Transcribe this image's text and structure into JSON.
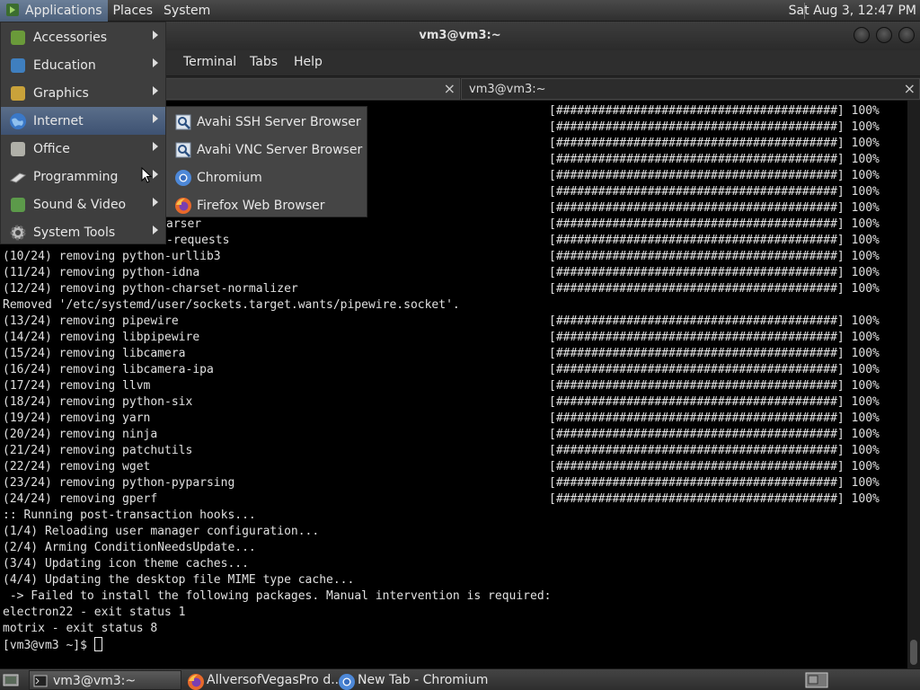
{
  "top_panel": {
    "applications": "Applications",
    "places": "Places",
    "system": "System",
    "clock": "Sat Aug  3, 12:47 PM"
  },
  "window": {
    "title": "vm3@vm3:~",
    "menu": {
      "terminal": "Terminal",
      "tabs": "Tabs",
      "help": "Help"
    },
    "tabs": [
      {
        "label": ""
      },
      {
        "label": "vm3@vm3:~"
      }
    ]
  },
  "terminal": {
    "partial_lines": [
      {
        "row": 7,
        "text": "arser"
      },
      {
        "row": 8,
        "text": "-requests"
      }
    ],
    "lines": [
      {
        "row": 9,
        "text": "(10/24) removing python-urllib3"
      },
      {
        "row": 10,
        "text": "(11/24) removing python-idna"
      },
      {
        "row": 11,
        "text": "(12/24) removing python-charset-normalizer"
      },
      {
        "row": 12,
        "text": "Removed '/etc/systemd/user/sockets.target.wants/pipewire.socket'."
      },
      {
        "row": 13,
        "text": "(13/24) removing pipewire"
      },
      {
        "row": 14,
        "text": "(14/24) removing libpipewire"
      },
      {
        "row": 15,
        "text": "(15/24) removing libcamera"
      },
      {
        "row": 16,
        "text": "(16/24) removing libcamera-ipa"
      },
      {
        "row": 17,
        "text": "(17/24) removing llvm"
      },
      {
        "row": 18,
        "text": "(18/24) removing python-six"
      },
      {
        "row": 19,
        "text": "(19/24) removing yarn"
      },
      {
        "row": 20,
        "text": "(20/24) removing ninja"
      },
      {
        "row": 21,
        "text": "(21/24) removing patchutils"
      },
      {
        "row": 22,
        "text": "(22/24) removing wget"
      },
      {
        "row": 23,
        "text": "(23/24) removing python-pyparsing"
      },
      {
        "row": 24,
        "text": "(24/24) removing gperf"
      },
      {
        "row": 25,
        "text": ":: Running post-transaction hooks..."
      },
      {
        "row": 26,
        "text": "(1/4) Reloading user manager configuration..."
      },
      {
        "row": 27,
        "text": "(2/4) Arming ConditionNeedsUpdate..."
      },
      {
        "row": 28,
        "text": "(3/4) Updating icon theme caches..."
      },
      {
        "row": 29,
        "text": "(4/4) Updating the desktop file MIME type cache..."
      },
      {
        "row": 30,
        "text": " -> Failed to install the following packages. Manual intervention is required:"
      },
      {
        "row": 31,
        "text": "electron22 - exit status 1"
      },
      {
        "row": 32,
        "text": "motrix - exit status 8"
      }
    ],
    "prompt": "[vm3@vm3 ~]$ ",
    "progress_bar": "[########################################] 100%",
    "progress_rows": [
      0,
      1,
      2,
      3,
      4,
      5,
      6,
      7,
      8,
      9,
      10,
      11,
      13,
      14,
      15,
      16,
      17,
      18,
      19,
      20,
      21,
      22,
      23,
      24
    ]
  },
  "apps_menu": {
    "items": [
      {
        "label": "Accessories",
        "icon": "accessories-icon",
        "color": "#6a9a3a"
      },
      {
        "label": "Education",
        "icon": "education-icon",
        "color": "#3f7fbf"
      },
      {
        "label": "Graphics",
        "icon": "graphics-icon",
        "color": "#c9a23a"
      },
      {
        "label": "Internet",
        "icon": "internet-icon",
        "color": "#4a86c8"
      },
      {
        "label": "Office",
        "icon": "office-icon",
        "color": "#b0b0a8"
      },
      {
        "label": "Programming",
        "icon": "programming-icon",
        "color": "#d8d8d8"
      },
      {
        "label": "Sound & Video",
        "icon": "sound-video-icon",
        "color": "#5c9a4a"
      },
      {
        "label": "System Tools",
        "icon": "system-tools-icon",
        "color": "#aaaaaa"
      }
    ]
  },
  "internet_submenu": {
    "items": [
      {
        "label": "Avahi SSH Server Browser",
        "icon": "avahi-ssh-icon"
      },
      {
        "label": "Avahi VNC Server Browser",
        "icon": "avahi-vnc-icon"
      },
      {
        "label": "Chromium",
        "icon": "chromium-icon"
      },
      {
        "label": "Firefox Web Browser",
        "icon": "firefox-icon"
      }
    ]
  },
  "taskbar": {
    "tasks": [
      {
        "label": "vm3@vm3:~",
        "icon": "terminal-icon"
      },
      {
        "label": "AllversofVegasPro d...",
        "icon": "firefox-icon"
      },
      {
        "label": "New Tab - Chromium",
        "icon": "chromium-icon"
      }
    ]
  }
}
